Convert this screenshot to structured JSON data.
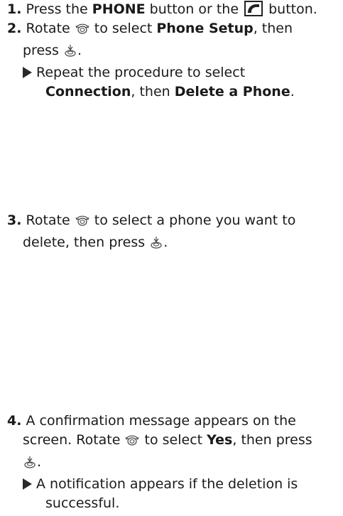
{
  "step1": {
    "num": "1.",
    "t1": "Press the ",
    "phone_label": "PHONE",
    "t2": " button or the ",
    "t3": " button.",
    "icon": "phone-handset-icon"
  },
  "step2": {
    "num": "2.",
    "t1": "Rotate ",
    "t2": " to select ",
    "phone_setup": "Phone Setup",
    "t3": ", then",
    "t4": "press ",
    "t5": ".",
    "sub_t1": "Repeat the procedure to select",
    "connection": "Connection",
    "sub_t2": ", then ",
    "delete_phone": "Delete a Phone",
    "sub_t3": "."
  },
  "step3": {
    "num": "3.",
    "t1": "Rotate ",
    "t2": " to select a phone you want to",
    "t3": "delete, then press ",
    "t4": "."
  },
  "step4": {
    "num": "4.",
    "t1": "A confirmation message appears on the",
    "t2": "screen. Rotate ",
    "t3": " to select ",
    "yes": "Yes",
    "t4": ", then press",
    "t5": ".",
    "sub_t1": "A notification appears if the deletion is",
    "sub_t2": "successful."
  },
  "icons": {
    "rotate": "interface-dial-rotate-icon",
    "press": "interface-dial-press-icon",
    "bullet": "triangle-bullet-icon"
  }
}
